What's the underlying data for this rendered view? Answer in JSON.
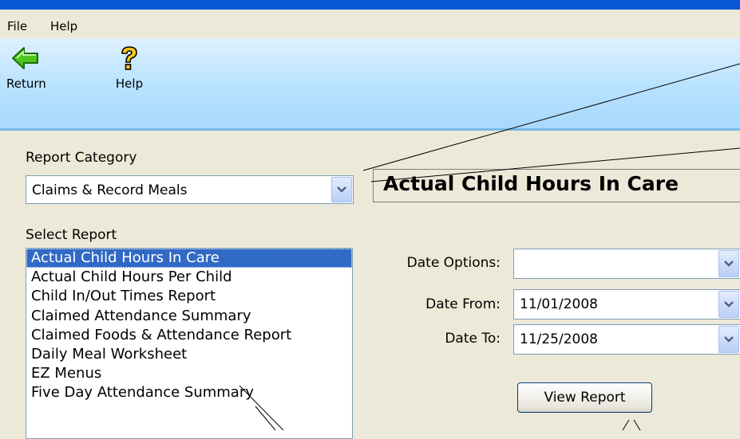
{
  "menu": {
    "file": "File",
    "help": "Help"
  },
  "toolbar": {
    "return_label": "Return",
    "help_label": "Help"
  },
  "report_category": {
    "label": "Report Category",
    "value": "Claims & Record Meals"
  },
  "report_title": "Actual Child Hours In Care",
  "select_report": {
    "label": "Select Report",
    "items": [
      "Actual Child Hours In Care",
      "Actual Child Hours Per Child",
      "Child In/Out Times Report",
      "Claimed Attendance Summary",
      "Claimed Foods & Attendance Report",
      "Daily Meal Worksheet",
      "EZ Menus",
      "Five Day Attendance Summary"
    ],
    "selected_index": 0
  },
  "date_options": {
    "label": "Date Options:",
    "value": ""
  },
  "date_from": {
    "label": "Date From:",
    "value": "11/01/2008"
  },
  "date_to": {
    "label": "Date To:",
    "value": "11/25/2008"
  },
  "view_report_label": "View Report",
  "icons": {
    "return": "back-arrow-icon",
    "help": "question-mark-icon",
    "dropdown": "chevron-down-icon"
  }
}
